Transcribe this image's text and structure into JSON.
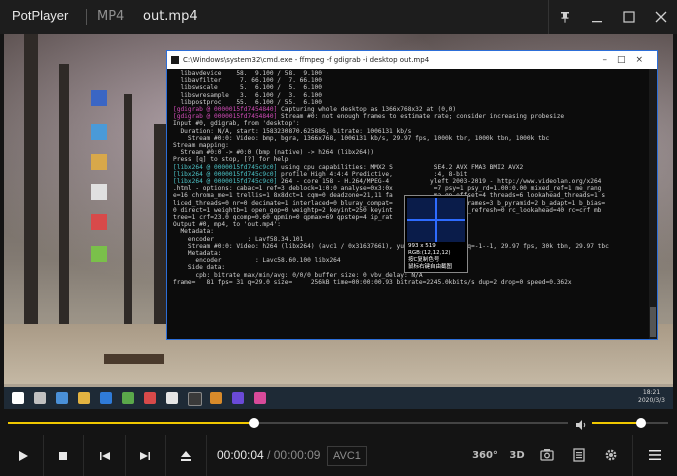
{
  "app": {
    "name": "PotPlayer",
    "format": "MP4",
    "filename": "out.mp4"
  },
  "cmd": {
    "title": "C:\\Windows\\system32\\cmd.exe - ffmpeg  -f gdigrab -i desktop out.mp4",
    "lines": [
      "  libavdevice    58.  9.100 / 58.  9.100",
      "  libavfilter     7. 66.100 /  7. 66.100",
      "  libswscale      5.  6.100 /  5.  6.100",
      "  libswresample   3.  6.100 /  3.  6.100",
      "  libpostproc    55.  6.100 / 55.  6.100",
      "[gdigrab @ 0000015fd7454840] Capturing whole desktop as 1366x768x32 at (0,0)",
      "[gdigrab @ 0000015fd7454840] Stream #0: not enough frames to estimate rate; consider increasing probesize",
      "Input #0, gdigrab, from 'desktop':",
      "  Duration: N/A, start: 1583230870.625886, bitrate: 1006131 kb/s",
      "    Stream #0:0: Video: bmp, bgra, 1366x768, 1006131 kb/s, 29.97 fps, 1000k tbr, 1000k tbn, 1000k tbc",
      "Stream mapping:",
      "  Stream #0:0 -> #0:0 (bmp (native) -> h264 (libx264))",
      "Press [q] to stop, [?] for help",
      "[libx264 @ 0000015fd745c9c0] using cpu capabilities: MMX2 S           SE4.2 AVX FMA3 BMI2 AVX2",
      "[libx264 @ 0000015fd745c9c0] profile High 4:4:4 Predictive,           :4, 8-bit",
      "[libx264 @ 0000015fd745c9c0] 264 - core 158 - H.264/MPEG-4           yleft 2003-2019 - http://www.videolan.org/x264",
      ".html - options: cabac=1 ref=3 deblock=1:0:0 analyse=0x3:0x           =7 psy=1 psy_rd=1.00:0.00 mixed_ref=1 me_rang",
      "e=16 chroma_me=1 trellis=1 8x8dct=1 cqm=0 deadzone=21,11 fa           ma_qp_offset=4 threads=6 lookahead_threads=1 s",
      "liced_threads=0 nr=0 decimate=1 interlaced=0 bluray_compat=           ntra=0 bframes=3 b_pyramid=2 b_adapt=1 b_bias=",
      "0 direct=1 weightb=1 open_gop=0 weightp=2 keyint=250 keyint           =40 intra_refresh=0 rc_lookahead=40 rc=crf mb",
      "tree=1 crf=23.0 qcomp=0.60 qpmin=0 qpmax=69 qpstep=4 ip_rat",
      "Output #0, mp4, to 'out.mp4':",
      "  Metadata:",
      "    encoder         : Lavf58.34.101",
      "    Stream #0:0: Video: h264 (libx264) (avc1 / 0x31637661), yuv444p, 1366x768, q=-1--1, 29.97 fps, 30k tbn, 29.97 tbc",
      "    Metadata:",
      "      encoder         : Lavc58.60.100 libx264",
      "    Side data:",
      "      cpb: bitrate max/min/avg: 0/0/0 buffer size: 0 vbv_delay: N/A",
      "frame=   81 fps= 31 q=29.0 size=     256kB time=00:00:00.93 bitrate=2245.0kbits/s dup=2 drop=0 speed=0.362x"
    ]
  },
  "overlay": {
    "size": "993 x 519",
    "rgb": "RGB:(12,12,12)",
    "hint1": "按C复制色号",
    "hint2": "鼠标右键自由截图"
  },
  "taskbar": {
    "time": "18:21",
    "date": "2020/3/3"
  },
  "player": {
    "current_time": "00:00:04",
    "separator": "/",
    "total_time": "00:00:09",
    "codec": "AVC1",
    "progress_fraction": 0.44,
    "volume_fraction": 0.64
  },
  "icons": {
    "play": "play-icon",
    "stop": "stop-icon",
    "prev": "previous-icon",
    "next": "next-icon",
    "eject": "eject-icon",
    "vr": "360-icon",
    "threed": "3d-icon",
    "capture": "capture-icon",
    "playlist": "playlist-icon",
    "settings": "settings-icon",
    "menu": "menu-icon",
    "pin": "pin-icon",
    "minimize": "minimize-icon",
    "maximize": "maximize-icon",
    "close": "close-icon",
    "volume": "volume-icon"
  },
  "labels": {
    "vr": "360°",
    "threed": "3D"
  },
  "colors": {
    "accent": "#f0c800",
    "background": "#141414",
    "cmd_border": "#2c6ed8"
  }
}
